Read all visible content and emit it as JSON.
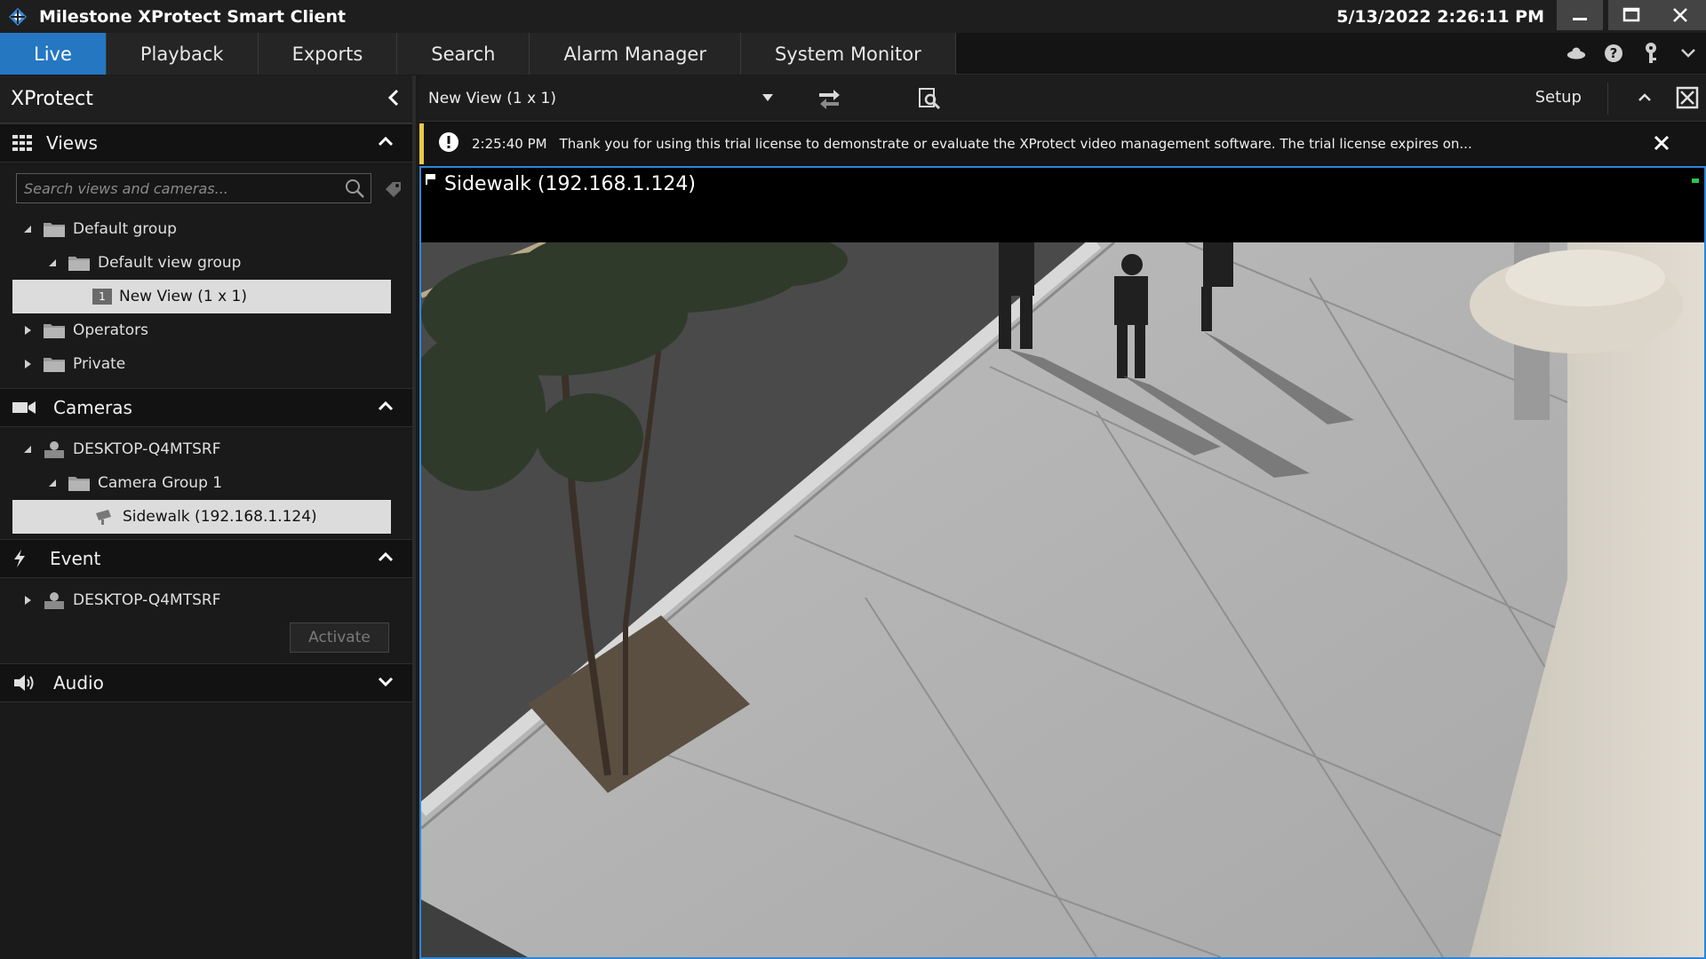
{
  "window": {
    "title": "Milestone XProtect Smart Client",
    "datetime": "5/13/2022 2:26:11 PM"
  },
  "nav": {
    "tabs": [
      {
        "label": "Live",
        "active": true
      },
      {
        "label": "Playback"
      },
      {
        "label": "Exports"
      },
      {
        "label": "Search"
      },
      {
        "label": "Alarm Manager"
      },
      {
        "label": "System Monitor"
      }
    ],
    "icons": [
      "status-cloud-icon",
      "help-icon",
      "key-icon",
      "chevron-down-icon"
    ]
  },
  "left": {
    "title": "XProtect",
    "views": {
      "label": "Views",
      "search_placeholder": "Search views and cameras...",
      "tree": {
        "default_group": "Default group",
        "default_view_group": "Default view group",
        "new_view": "New View (1 x 1)",
        "new_view_badge": "1",
        "operators": "Operators",
        "private": "Private"
      }
    },
    "cameras": {
      "label": "Cameras",
      "server": "DESKTOP-Q4MTSRF",
      "group": "Camera Group 1",
      "camera": "Sidewalk (192.168.1.124)"
    },
    "event": {
      "label": "Event",
      "server": "DESKTOP-Q4MTSRF",
      "activate": "Activate"
    },
    "audio": {
      "label": "Audio"
    }
  },
  "right": {
    "view_name": "New View (1 x 1)",
    "setup": "Setup",
    "notification": {
      "time": "2:25:40 PM",
      "message": "Thank you for using this trial license to demonstrate or evaluate the XProtect video management software. The trial license expires on..."
    },
    "camera_title": "Sidewalk (192.168.1.124)"
  },
  "colors": {
    "accent": "#2577c2",
    "frame_border": "#2e86d8",
    "notice": "#e8c94a",
    "live_indicator": "#2cc34b"
  }
}
